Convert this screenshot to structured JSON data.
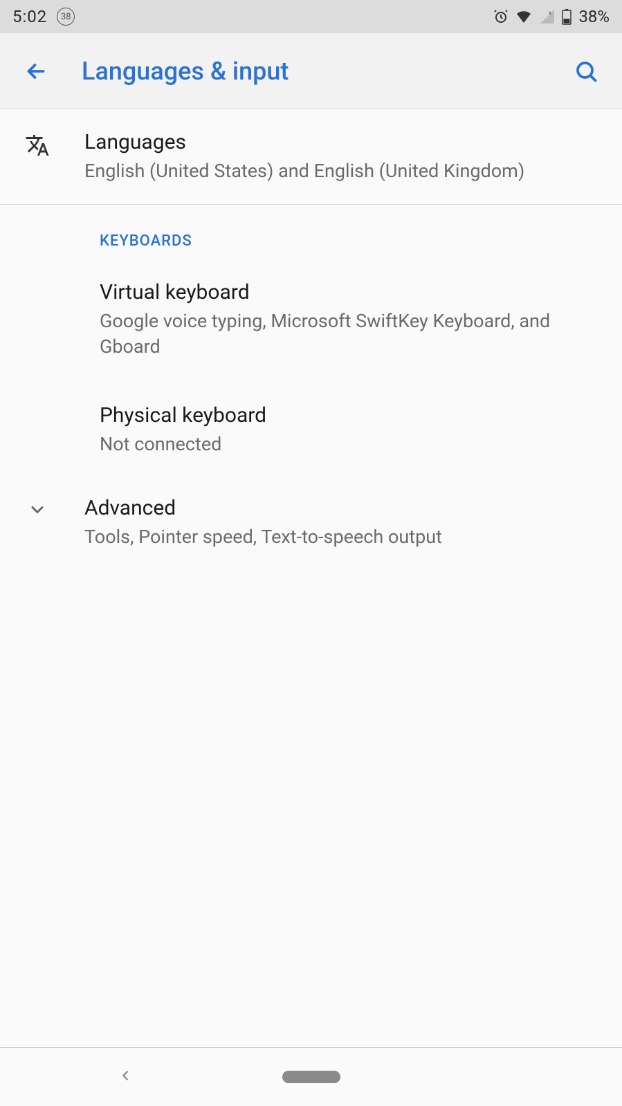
{
  "status": {
    "time": "5:02",
    "badge": "38",
    "battery": "38%"
  },
  "header": {
    "title": "Languages & input"
  },
  "items": {
    "languages": {
      "title": "Languages",
      "subtitle": "English (United States) and English (United Kingdom)"
    },
    "section_keyboards": "KEYBOARDS",
    "virtual": {
      "title": "Virtual keyboard",
      "subtitle": "Google voice typing, Microsoft SwiftKey Keyboard, and Gboard"
    },
    "physical": {
      "title": "Physical keyboard",
      "subtitle": "Not connected"
    },
    "advanced": {
      "title": "Advanced",
      "subtitle": "Tools, Pointer speed, Text-to-speech output"
    }
  }
}
